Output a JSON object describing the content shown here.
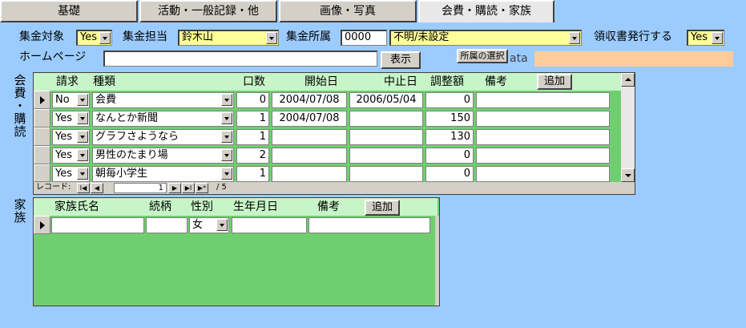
{
  "tabs": [
    "基礎",
    "活動・一般記録・他",
    "画像・写真",
    "会費・購読・家族"
  ],
  "form": {
    "target_label": "集金対象",
    "target_value": "Yes",
    "person_label": "集金担当",
    "person_value": "鈴木山",
    "affil_label": "集金所属",
    "affil_code": "0000",
    "affil_name": "不明/未設定",
    "receipt_label": "領収書発行する",
    "receipt_value": "Yes",
    "homepage_label": "ホームページ",
    "homepage_value": "",
    "show_button": "表示",
    "affil_select_button": "所属の選択",
    "data_label": "ata",
    "data_value": ""
  },
  "subscriptions": {
    "side_label": [
      "会",
      "費",
      "・",
      "購",
      "読"
    ],
    "headers": {
      "request": "請求",
      "kind": "種類",
      "units": "口数",
      "start": "開始日",
      "stop": "中止日",
      "adjust": "調整額",
      "note": "備考"
    },
    "add_button": "追加",
    "rows": [
      {
        "request": "No",
        "kind": "会費",
        "units": "0",
        "start": "2004/07/08",
        "stop": "2006/05/04",
        "adjust": "0",
        "note": ""
      },
      {
        "request": "Yes",
        "kind": "なんとか新聞",
        "units": "1",
        "start": "2004/07/08",
        "stop": "",
        "adjust": "150",
        "note": ""
      },
      {
        "request": "Yes",
        "kind": "グラフさようなら",
        "units": "1",
        "start": "",
        "stop": "",
        "adjust": "130",
        "note": ""
      },
      {
        "request": "Yes",
        "kind": "男性のたまり場",
        "units": "2",
        "start": "",
        "stop": "",
        "adjust": "0",
        "note": ""
      },
      {
        "request": "Yes",
        "kind": "朝毎小学生",
        "units": "1",
        "start": "",
        "stop": "",
        "adjust": "0",
        "note": ""
      }
    ],
    "nav": {
      "label": "レコード:",
      "current": "1",
      "total": "/ 5",
      "first": "I◀",
      "prev": "◀",
      "next": "▶",
      "last": "▶I",
      "new": "▶*"
    }
  },
  "family": {
    "side_label": [
      "家",
      "族"
    ],
    "headers": {
      "name": "家族氏名",
      "relation": "続柄",
      "gender": "性別",
      "birth": "生年月日",
      "note": "備考"
    },
    "add_button": "追加",
    "row": {
      "name": "",
      "relation": "",
      "gender": "女",
      "birth": "",
      "note": ""
    }
  },
  "colors": {
    "background": "#9cccff",
    "panel_green": "#6fcf70",
    "header_green": "#c8f5c8",
    "field_yellow": "#ffff99",
    "data_orange": "#ffcc99"
  },
  "icons": {
    "record_selector": "black-right-triangle",
    "dropdown": "down-arrow",
    "scroll_up": "up-arrow",
    "scroll_down": "down-arrow"
  }
}
